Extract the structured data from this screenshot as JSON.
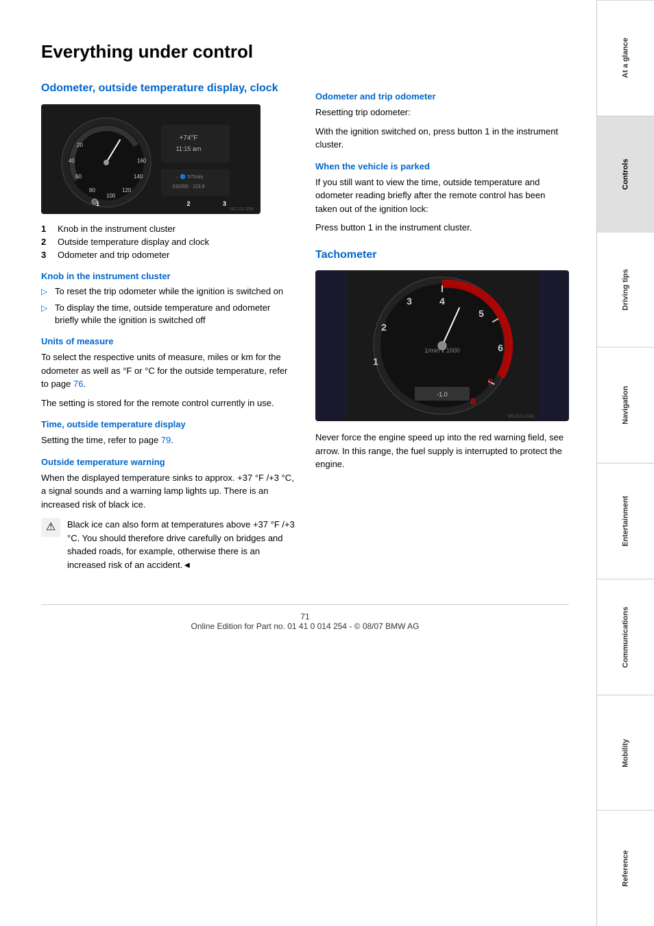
{
  "page": {
    "title": "Everything under control"
  },
  "left_section": {
    "heading": "Odometer, outside temperature display, clock",
    "items": [
      {
        "number": "1",
        "label": "Knob in the instrument cluster"
      },
      {
        "number": "2",
        "label": "Outside temperature display and clock"
      },
      {
        "number": "3",
        "label": "Odometer and trip odometer"
      }
    ],
    "subsections": [
      {
        "id": "knob",
        "title": "Knob in the instrument cluster",
        "bullets": [
          "To reset the trip odometer while the ignition is switched on",
          "To display the time, outside temperature and odometer briefly while the ignition is switched off"
        ]
      },
      {
        "id": "units",
        "title": "Units of measure",
        "body": "To select the respective units of measure, miles or km for the odometer as well as  °F  or  °C for the outside temperature, refer to page 76.",
        "body2": "The setting is stored for the remote control currently in use."
      },
      {
        "id": "time_display",
        "title": "Time, outside temperature display",
        "body": "Setting the time, refer to page 79."
      },
      {
        "id": "outside_warning",
        "title": "Outside temperature warning",
        "body": "When the displayed temperature sinks to approx. +37 °F /+3 °C, a signal sounds and a warning lamp lights up. There is an increased risk of black ice.",
        "warning_box": "Black ice can also form at temperatures above +37 °F /+3 °C. You should therefore drive carefully on bridges and shaded roads, for example, otherwise there is an increased risk of an accident.◄"
      }
    ]
  },
  "right_section": {
    "odometer_subsection": {
      "title": "Odometer and trip odometer",
      "body": "Resetting trip odometer:",
      "body2": "With the ignition switched on, press button 1 in the instrument cluster."
    },
    "parked_subsection": {
      "title": "When the vehicle is parked",
      "body": "If you still want to view the time, outside temperature and odometer reading briefly after the remote control has been taken out of the ignition lock:",
      "body2": "Press button 1 in the instrument cluster."
    },
    "tachometer": {
      "heading": "Tachometer",
      "body": "Never force the engine speed up into the red warning field, see arrow. In this range, the fuel supply is interrupted to protect the engine."
    }
  },
  "sidebar": {
    "tabs": [
      {
        "label": "At a glance",
        "active": false
      },
      {
        "label": "Controls",
        "active": true
      },
      {
        "label": "Driving tips",
        "active": false
      },
      {
        "label": "Navigation",
        "active": false
      },
      {
        "label": "Entertainment",
        "active": false
      },
      {
        "label": "Communications",
        "active": false
      },
      {
        "label": "Mobility",
        "active": false
      },
      {
        "label": "Reference",
        "active": false
      }
    ]
  },
  "footer": {
    "page_number": "71",
    "text": "Online Edition for Part no. 01 41 0 014 254 - © 08/07 BMW AG"
  }
}
